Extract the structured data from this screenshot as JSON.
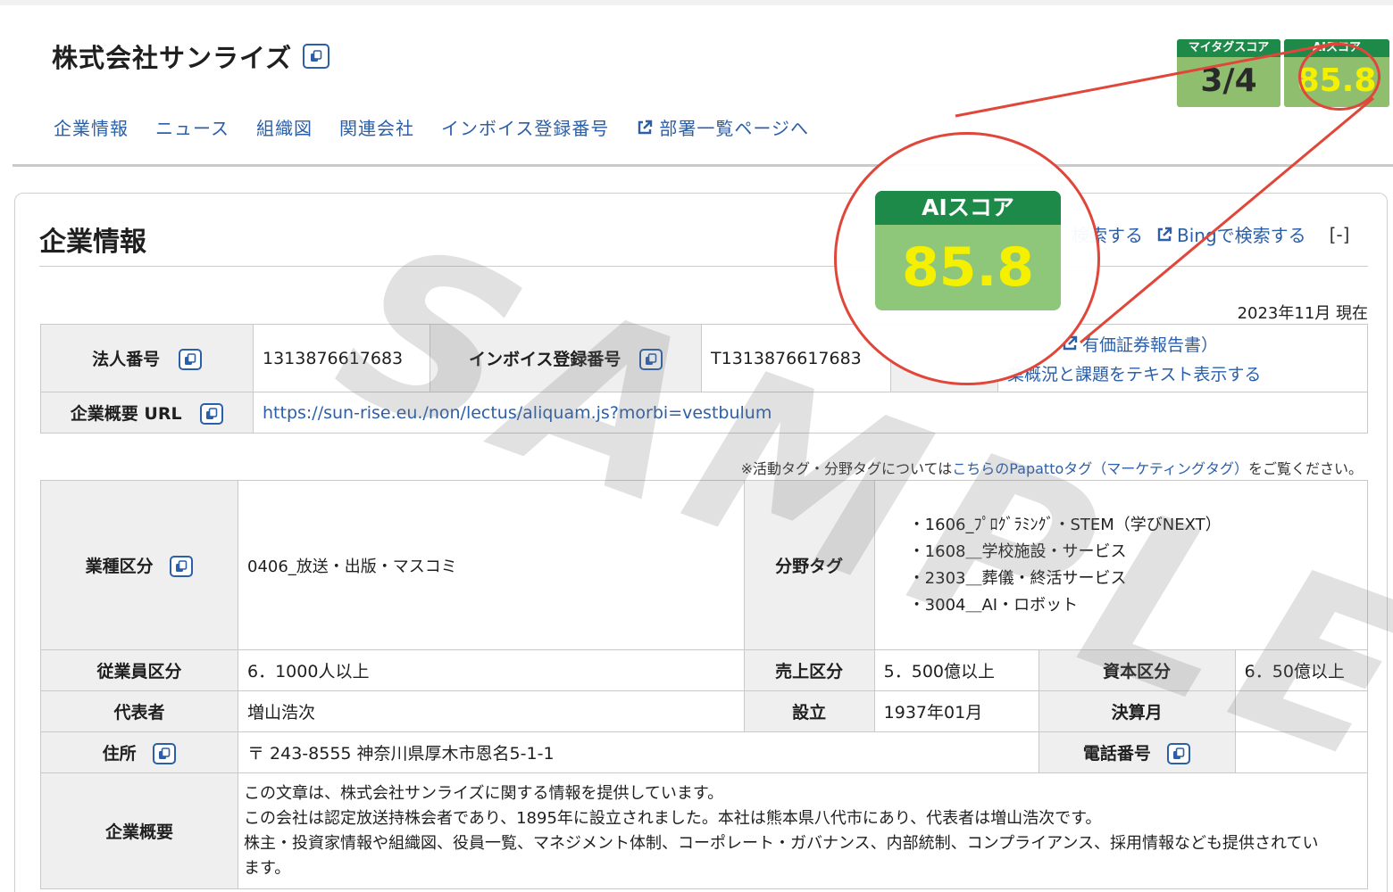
{
  "company": {
    "name": "株式会社サンライズ"
  },
  "nav": {
    "items": [
      "企業情報",
      "ニュース",
      "組織図",
      "関連会社",
      "インボイス登録番号"
    ],
    "dept_link": "部署一覧ページへ"
  },
  "scores": {
    "mytag": {
      "label": "マイタグスコア",
      "value": "3/4"
    },
    "ai": {
      "label": "AIスコア",
      "value": "85.8"
    }
  },
  "section": {
    "title": "企業情報",
    "search_google": "検索する",
    "search_bing": "Bingで検索する",
    "collapse": "[-]",
    "as_of": "2023年11月 現在"
  },
  "info": {
    "corp_no_label": "法人番号",
    "corp_no": "1313876617683",
    "invoice_label": "インボイス登録番号",
    "invoice_no": "T1313876617683",
    "securities_report": "有価証券報告書）",
    "business_text_link": "業概況と課題をテキスト表示する",
    "url_label": "企業概要 URL",
    "url": "https://sun-rise.eu./non/lectus/aliquam.js?morbi=vestbulum"
  },
  "notice": {
    "prefix": "※活動タグ・分野タグについては",
    "link": "こちらのPapattoタグ（マーケティングタグ）",
    "suffix": "をご覧ください。"
  },
  "details": {
    "industry_label": "業種区分",
    "industry": "0406_放送・出版・マスコミ",
    "field_tags_label": "分野タグ",
    "field_tags": [
      "・1606_ﾌﾟﾛｸﾞﾗﾐﾝｸﾞ・STEM（学びNEXT）",
      "・1608＿学校施設・サービス",
      "・2303＿葬儀・終活サービス",
      "・3004＿AI・ロボット"
    ],
    "employees_label": "従業員区分",
    "employees": "6．1000人以上",
    "sales_label": "売上区分",
    "sales": "5．500億以上",
    "capital_label": "資本区分",
    "capital": "6．50億以上",
    "rep_label": "代表者",
    "rep": "増山浩次",
    "founded_label": "設立",
    "founded": "1937年01月",
    "fiscal_label": "決算月",
    "fiscal": "",
    "address_label": "住所",
    "address": "〒 243-8555 神奈川県厚木市恩名5-1-1",
    "phone_label": "電話番号",
    "phone": "",
    "summary_label": "企業概要",
    "summary_lines": [
      "この文章は、株式会社サンライズに関する情報を提供しています。",
      "この会社は認定放送持株会者であり、1895年に設立されました。本社は熊本県八代市にあり、代表者は増山浩次です。",
      "株主・投資家情報や組織図、役員一覧、マネジメント体制、コーポレート・ガバナンス、内部統制、コンプライアンス、採用情報なども提供されてい",
      "ます。"
    ]
  },
  "watermark": "SAMPLE",
  "colors": {
    "link": "#2b5fa8",
    "score_header": "#1e8a4a",
    "score_bg": "#8fbe6f",
    "score_value": "#f4f000",
    "callout": "#e0463a"
  }
}
